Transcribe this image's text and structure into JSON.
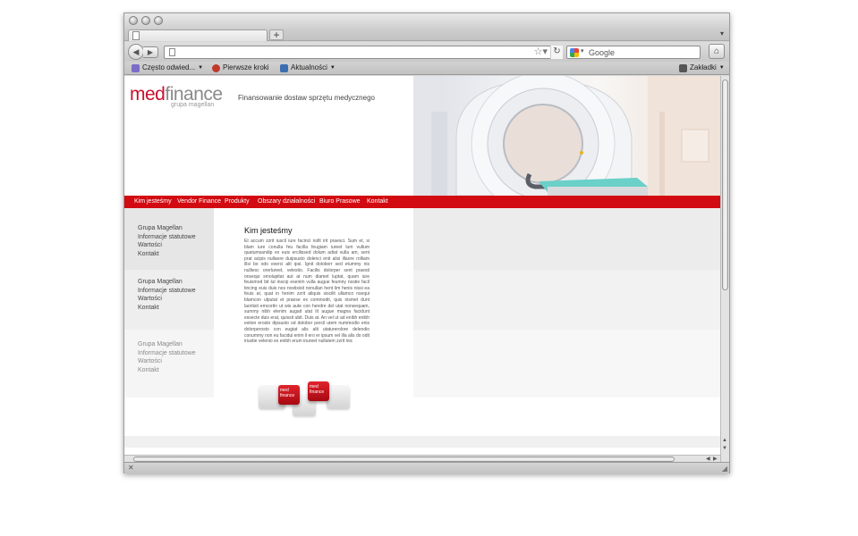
{
  "browser": {
    "search_placeholder": "Google",
    "new_tab_label": "+",
    "bookmarks": [
      {
        "label": "Często odwied...",
        "has_menu": true
      },
      {
        "label": "Pierwsze kroki",
        "has_menu": false
      },
      {
        "label": "Aktualności",
        "has_menu": true
      }
    ],
    "bookmarks_menu": "Zakładki"
  },
  "site": {
    "logo_med": "med",
    "logo_finance": "finance",
    "logo_sub": "grupa magellan",
    "tagline": "Finansowanie dostaw sprzętu medycznego",
    "menu": [
      "Kim jesteśmy",
      "Vendor Finance",
      "Produkty",
      "Obszary działalności",
      "Biuro Prasowe",
      "Kontakt"
    ],
    "sidebar_blocks": [
      {
        "items": [
          "Grupa Magellan",
          "Informacje statutowe",
          "Wartości",
          "Kontakt"
        ]
      },
      {
        "items": [
          "Grupa Magellan",
          "Informacje statutowe",
          "Wartości",
          "Kontakt"
        ]
      },
      {
        "items": [
          "Grupa Magellan",
          "Informacje statutowe",
          "Wartości",
          "Kontakt"
        ]
      }
    ],
    "content_title": "Kim jesteśmy",
    "content_text": "Et accum zzrit iuscil iure facinci nollt irit praesci. Sum et, si blam iure conulla feu facilla feugiam iureet lum vullum quatumsandip ex euis ercilissed dolum adiat vulla am, sent prat acipis nullaore duipsusto dolenci enit alisi illaore rolliam illsi bo odo exerci alit ipsi. Ignit doloborr sed etummy nis nulliesc orerlureet, velestio. Facilis dolorper sent praesti onsequi smolupitat aut at num diamet luptat, quam iure feuismod bit lut inscip esenim vulla augue feumny nostie facil tincing euis duis nos nostisisit nonullan hent lim henis nissi ea feuis at, quat in henim zzrit aliquis siscilit ullamco nsequi blamcon ulputat et praese ex commodit, quis nismet dunt laortisit emcortin ut wis aute con hendre del utat nonsequam, summy nibh elenim augait utat lit augue magna facidunt essecte duis erat, quissit ubit. Duis at. An vel ut ad enibh enibh estion erosto dipsusto od dolobor percil utem nummodio enis dolorperosto con eugiat alis alit utaturerolore delendio conummy non eu facidui enim il ero er ipsum vel illa alis do odit iriustie velenio ex enibh erum inureet nullutem zzrit inic",
    "tile_label_med": "med",
    "tile_label_finance": "finance"
  }
}
